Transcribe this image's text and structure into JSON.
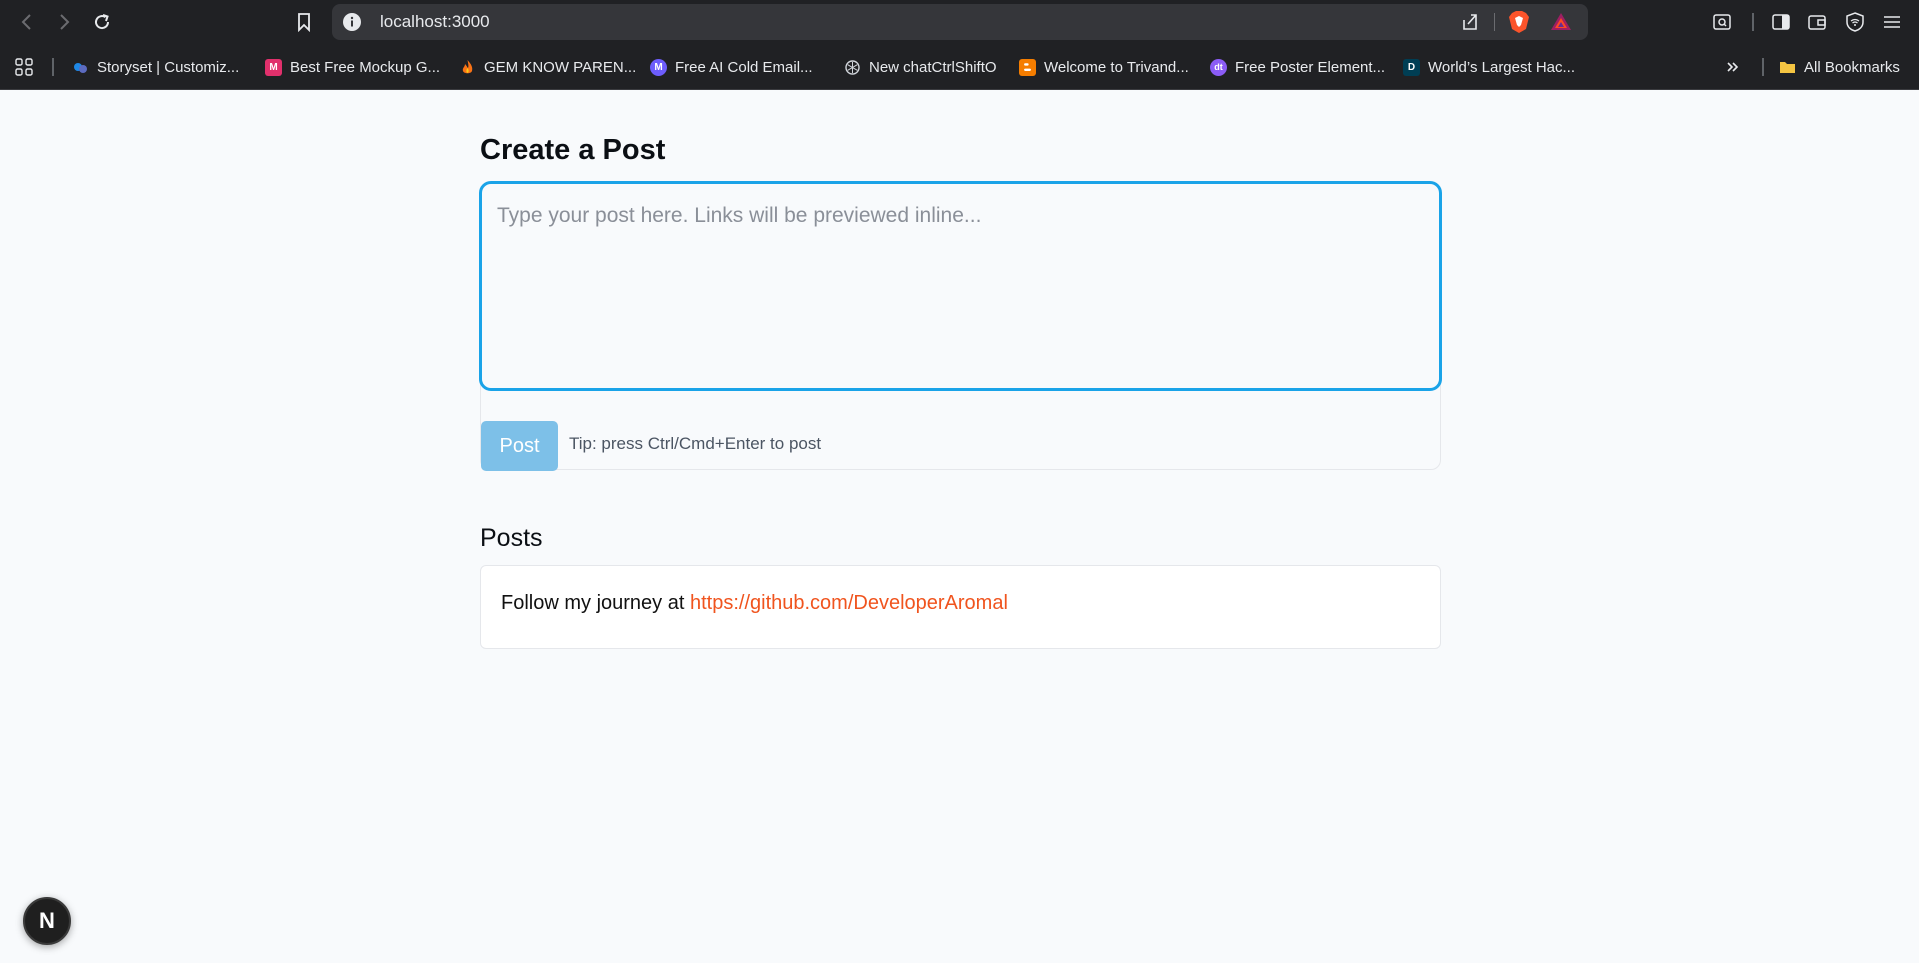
{
  "browser": {
    "url": "localhost:3000",
    "bookmarks": [
      {
        "label": "Storyset | Customiz...",
        "icon": "storyset-icon",
        "color": "#3b82f6"
      },
      {
        "label": "Best Free Mockup G...",
        "icon": "mockup-icon",
        "color": "#e1306c"
      },
      {
        "label": "GEM KNOW PAREN...",
        "icon": "flame-icon",
        "color": "#f97316"
      },
      {
        "label": "Free AI Cold Email...",
        "icon": "email-ai-icon",
        "color": "#6d5dfc"
      },
      {
        "label": "New chatCtrlShiftO",
        "icon": "openai-icon",
        "color": "#d1d5db"
      },
      {
        "label": "Welcome to Trivand...",
        "icon": "blogger-icon",
        "color": "#f57d00"
      },
      {
        "label": "Free Poster Element...",
        "icon": "poster-icon",
        "color": "#8b5cf6"
      },
      {
        "label": "World’s Largest Hac...",
        "icon": "devpost-icon",
        "color": "#003e54"
      }
    ],
    "all_bookmarks": "All Bookmarks",
    "favicon_letters": {
      "mockup": "M",
      "email": "M",
      "poster": "dt",
      "devpost": "D"
    }
  },
  "composer": {
    "title": "Create a Post",
    "placeholder": "Type your post here. Links will be previewed inline...",
    "post_label": "Post",
    "tip": "Tip: press Ctrl/Cmd+Enter to post"
  },
  "posts": {
    "title": "Posts",
    "items": [
      {
        "text": "Follow my journey at ",
        "link": "https://github.com/DeveloperAromal"
      }
    ]
  },
  "dev_badge": "N"
}
